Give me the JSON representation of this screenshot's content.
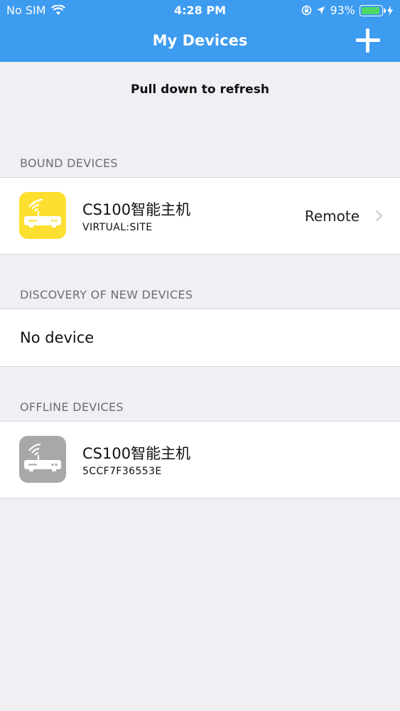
{
  "status": {
    "carrier": "No SIM",
    "time": "4:28 PM",
    "battery_percent": "93%",
    "battery_level": 0.93
  },
  "nav": {
    "title": "My Devices",
    "add_icon": "plus-icon"
  },
  "refresh_hint": "Pull down to refresh",
  "bound": {
    "header": "BOUND DEVICES",
    "device": {
      "name": "CS100智能主机",
      "subtitle": "VIRTUAL:SITE",
      "status": "Remote"
    }
  },
  "discovery": {
    "header": "DISCOVERY OF NEW DEVICES",
    "empty": "No device"
  },
  "offline": {
    "header": "OFFLINE DEVICES",
    "device": {
      "name": "CS100智能主机",
      "subtitle": "5CCF7F36553E"
    }
  },
  "colors": {
    "nav_bar": "#3d9bf0",
    "online_icon": "#fddf2f",
    "offline_icon": "#a8a8a8",
    "battery": "#4cd964"
  }
}
